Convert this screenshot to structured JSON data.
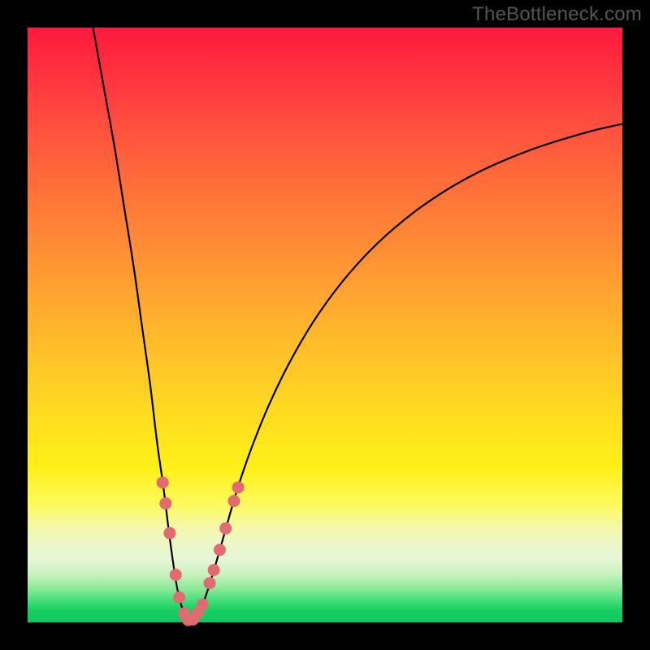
{
  "watermark": "TheBottleneck.com",
  "chart_data": {
    "type": "line",
    "title": "",
    "xlabel": "",
    "ylabel": "",
    "xlim": [
      0,
      100
    ],
    "ylim": [
      0,
      100
    ],
    "legend": false,
    "grid": false,
    "gradient_stops": [
      {
        "pct": 0,
        "color": "#ff1a3c"
      },
      {
        "pct": 15,
        "color": "#ff4a3f"
      },
      {
        "pct": 36,
        "color": "#ff8a35"
      },
      {
        "pct": 56,
        "color": "#ffc428"
      },
      {
        "pct": 74,
        "color": "#fff018"
      },
      {
        "pct": 87,
        "color": "#ecf7c8"
      },
      {
        "pct": 96,
        "color": "#3fdc78"
      },
      {
        "pct": 100,
        "color": "#10c85c"
      }
    ],
    "series": [
      {
        "name": "left-arm",
        "values": [
          {
            "x": 11.0,
            "y": 100.0
          },
          {
            "x": 12.8,
            "y": 90.0
          },
          {
            "x": 14.6,
            "y": 80.0
          },
          {
            "x": 16.2,
            "y": 70.0
          },
          {
            "x": 17.8,
            "y": 60.0
          },
          {
            "x": 19.2,
            "y": 50.0
          },
          {
            "x": 20.6,
            "y": 40.0
          },
          {
            "x": 21.8,
            "y": 30.0
          },
          {
            "x": 22.8,
            "y": 23.0
          },
          {
            "x": 23.6,
            "y": 16.5
          },
          {
            "x": 24.4,
            "y": 10.5
          },
          {
            "x": 25.2,
            "y": 5.5
          },
          {
            "x": 26.2,
            "y": 1.8
          },
          {
            "x": 27.2,
            "y": 0.3
          }
        ]
      },
      {
        "name": "right-arm",
        "values": [
          {
            "x": 27.2,
            "y": 0.3
          },
          {
            "x": 28.2,
            "y": 0.8
          },
          {
            "x": 29.2,
            "y": 2.4
          },
          {
            "x": 30.4,
            "y": 5.8
          },
          {
            "x": 31.8,
            "y": 10.4
          },
          {
            "x": 33.4,
            "y": 16.0
          },
          {
            "x": 35.2,
            "y": 22.2
          },
          {
            "x": 37.6,
            "y": 29.2
          },
          {
            "x": 40.6,
            "y": 36.6
          },
          {
            "x": 44.2,
            "y": 44.0
          },
          {
            "x": 48.6,
            "y": 51.4
          },
          {
            "x": 54.0,
            "y": 58.6
          },
          {
            "x": 60.4,
            "y": 65.2
          },
          {
            "x": 67.8,
            "y": 71.0
          },
          {
            "x": 76.0,
            "y": 75.8
          },
          {
            "x": 85.0,
            "y": 79.6
          },
          {
            "x": 94.0,
            "y": 82.4
          },
          {
            "x": 100.0,
            "y": 83.8
          }
        ]
      }
    ],
    "markers": {
      "color": "#e46a72",
      "radius_px": 7.5,
      "points": [
        {
          "x": 22.7,
          "y": 23.5
        },
        {
          "x": 23.2,
          "y": 20.0
        },
        {
          "x": 23.9,
          "y": 15.0
        },
        {
          "x": 24.9,
          "y": 8.0
        },
        {
          "x": 25.5,
          "y": 4.2
        },
        {
          "x": 26.3,
          "y": 1.5
        },
        {
          "x": 27.0,
          "y": 0.4
        },
        {
          "x": 27.8,
          "y": 0.5
        },
        {
          "x": 28.6,
          "y": 1.6
        },
        {
          "x": 29.4,
          "y": 3.0
        },
        {
          "x": 30.6,
          "y": 6.6
        },
        {
          "x": 31.3,
          "y": 8.8
        },
        {
          "x": 32.3,
          "y": 12.2
        },
        {
          "x": 33.3,
          "y": 15.8
        },
        {
          "x": 34.7,
          "y": 20.4
        },
        {
          "x": 35.4,
          "y": 22.7
        }
      ]
    },
    "minimum": {
      "x": 27.2,
      "y": 0.3
    }
  }
}
